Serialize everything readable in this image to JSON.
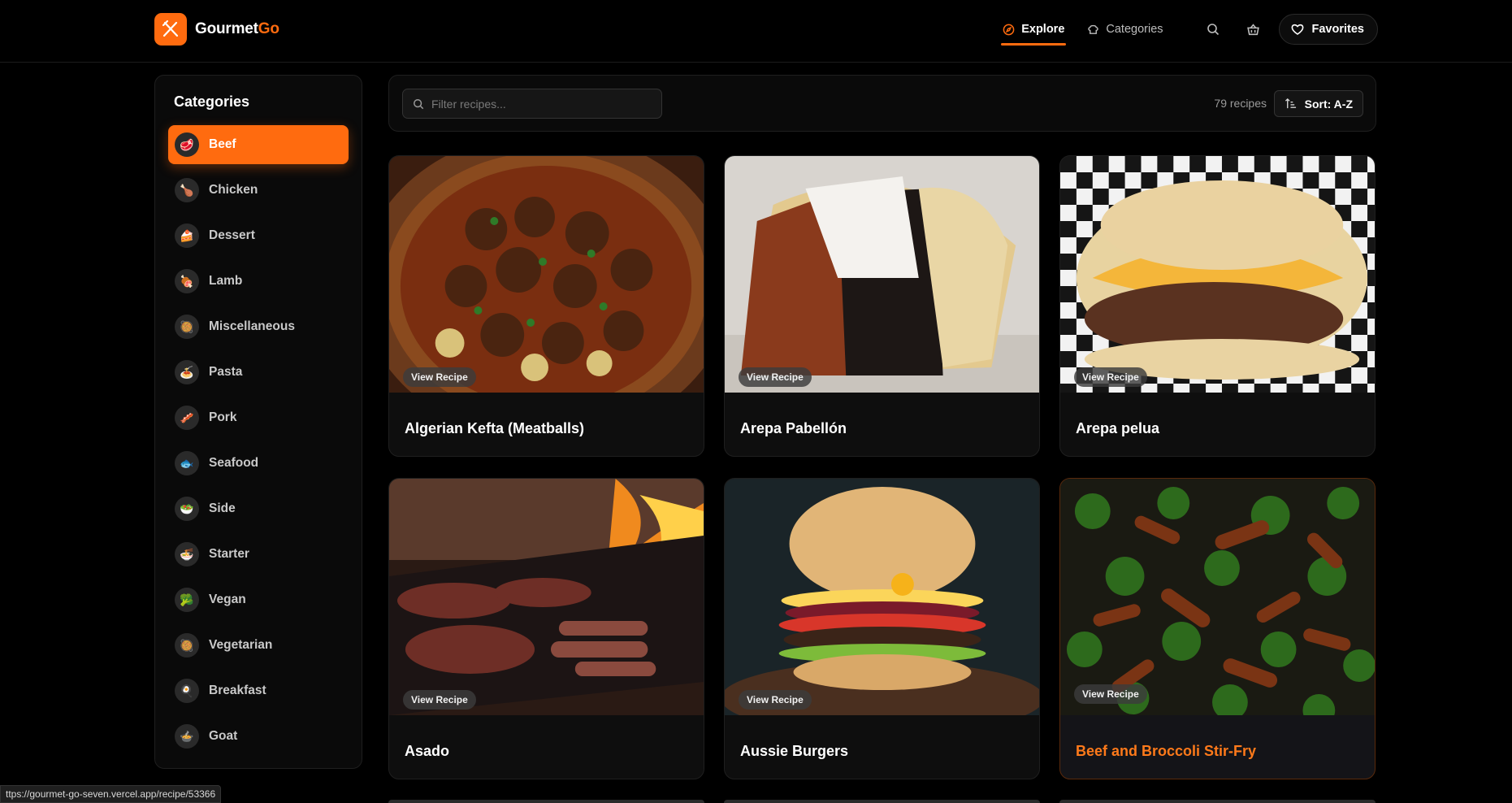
{
  "brand": {
    "name_main": "Gourmet",
    "name_accent": "Go"
  },
  "nav": {
    "explore": "Explore",
    "categories": "Categories",
    "favorites": "Favorites"
  },
  "sidebar": {
    "title": "Categories",
    "items": [
      {
        "label": "Beef",
        "active": true
      },
      {
        "label": "Chicken"
      },
      {
        "label": "Dessert"
      },
      {
        "label": "Lamb"
      },
      {
        "label": "Miscellaneous"
      },
      {
        "label": "Pasta"
      },
      {
        "label": "Pork"
      },
      {
        "label": "Seafood"
      },
      {
        "label": "Side"
      },
      {
        "label": "Starter"
      },
      {
        "label": "Vegan"
      },
      {
        "label": "Vegetarian"
      },
      {
        "label": "Breakfast"
      },
      {
        "label": "Goat"
      }
    ]
  },
  "filter": {
    "placeholder": "Filter recipes...",
    "count": "79 recipes",
    "sort_label": "Sort: A-Z"
  },
  "recipes": [
    {
      "title": "Algerian Kefta (Meatballs)",
      "cta": "View Recipe"
    },
    {
      "title": "Arepa Pabellón",
      "cta": "View Recipe"
    },
    {
      "title": "Arepa pelua",
      "cta": "View Recipe"
    },
    {
      "title": "Asado",
      "cta": "View Recipe"
    },
    {
      "title": "Aussie Burgers",
      "cta": "View Recipe"
    },
    {
      "title": "Beef and Broccoli Stir-Fry",
      "cta": "View Recipe"
    }
  ],
  "status_bar": {
    "url": "ttps://gourmet-go-seven.vercel.app/recipe/53366"
  },
  "colors": {
    "accent": "#ff6b0f",
    "bg": "#000000",
    "panel": "#0a0a0a"
  }
}
